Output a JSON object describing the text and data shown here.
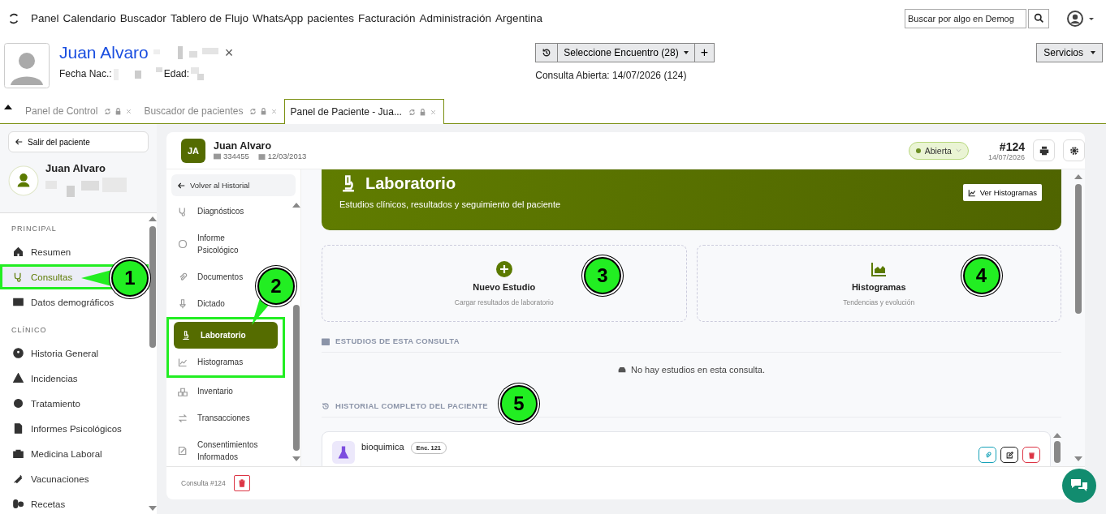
{
  "nav": {
    "items": [
      "Panel",
      "Calendario",
      "Buscador",
      "Tablero de Flujo",
      "WhatsApp",
      "pacientes",
      "Facturación",
      "Administración",
      "Argentina"
    ],
    "search": {
      "placeholder": "Buscar por algo en Demog"
    }
  },
  "patient": {
    "name": "Juan Alvaro",
    "close": "×",
    "birth_label": "Fecha Nac.:",
    "age_label": "Edad:"
  },
  "encounter": {
    "select": "Seleccione Encuentro  (28)",
    "add": "+",
    "current": "Consulta Abierta: 14/07/2026 (124)"
  },
  "services": "Servicios",
  "tabs": [
    {
      "label": "Panel de Control",
      "selected": false
    },
    {
      "label": "Buscador de pacientes",
      "selected": false
    },
    {
      "label": "Panel de Paciente - Jua...",
      "selected": true
    }
  ],
  "sidebar": {
    "exit": "Salir del paciente",
    "name": "Juan Alvaro",
    "sections": [
      {
        "title": "PRINCIPAL",
        "items": [
          {
            "label": "Resumen",
            "selected": false,
            "highlighted": false
          },
          {
            "label": "Consultas",
            "selected": true,
            "highlighted": true
          },
          {
            "label": "Datos demográficos",
            "selected": false,
            "highlighted": false
          }
        ]
      },
      {
        "title": "CLÍNICO",
        "items": [
          {
            "label": "Historia General",
            "selected": false,
            "highlighted": false
          },
          {
            "label": "Incidencias",
            "selected": false,
            "highlighted": false
          },
          {
            "label": "Tratamiento",
            "selected": false,
            "highlighted": false
          },
          {
            "label": "Informes Psicológicos",
            "selected": false,
            "highlighted": false
          },
          {
            "label": "Medicina Laboral",
            "selected": false,
            "highlighted": false
          },
          {
            "label": "Vacunaciones",
            "selected": false,
            "highlighted": false
          },
          {
            "label": "Recetas",
            "selected": false,
            "highlighted": false
          }
        ]
      }
    ]
  },
  "card": {
    "initials": "JA",
    "name": "Juan Alvaro",
    "id": "334455",
    "birth": "12/03/2013",
    "status": {
      "label": "Abierta",
      "color": "#6b8e23"
    },
    "number": "#124",
    "date": "14/07/2026"
  },
  "submenu": {
    "back": "Volver al Historial",
    "items": [
      {
        "label": "Diagnósticos",
        "selected": false,
        "highlighted": false
      },
      {
        "label": "Informe Psicológico",
        "selected": false,
        "highlighted": false
      },
      {
        "label": "Documentos",
        "selected": false,
        "highlighted": false
      },
      {
        "label": "Dictado",
        "selected": false,
        "highlighted": false
      },
      {
        "label": "Laboratorio",
        "selected": true,
        "highlighted": true
      },
      {
        "label": "Histogramas",
        "selected": false,
        "highlighted": true
      },
      {
        "label": "Inventario",
        "selected": false,
        "highlighted": false
      },
      {
        "label": "Transacciones",
        "selected": false,
        "highlighted": false
      },
      {
        "label": "Consentimientos Informados",
        "selected": false,
        "highlighted": false
      }
    ],
    "footer": "Consulta #124"
  },
  "lab": {
    "title": "Laboratorio",
    "subtitle": "Estudios clínicos, resultados y seguimiento del paciente",
    "histo_button": "Ver Histogramas",
    "actions": [
      {
        "title": "Nuevo Estudio",
        "subtitle": "Cargar resultados de laboratorio"
      },
      {
        "title": "Histogramas",
        "subtitle": "Tendencias y evolución"
      }
    ],
    "current_title": "ESTUDIOS DE ESTA CONSULTA",
    "empty": "No hay estudios en esta consulta.",
    "history_title": "HISTORIAL COMPLETO DEL PACIENTE",
    "studies": [
      {
        "name": "bioquimica",
        "encounter": "Enc. 121"
      }
    ]
  },
  "callouts": [
    "1",
    "2",
    "3",
    "4",
    "5"
  ]
}
